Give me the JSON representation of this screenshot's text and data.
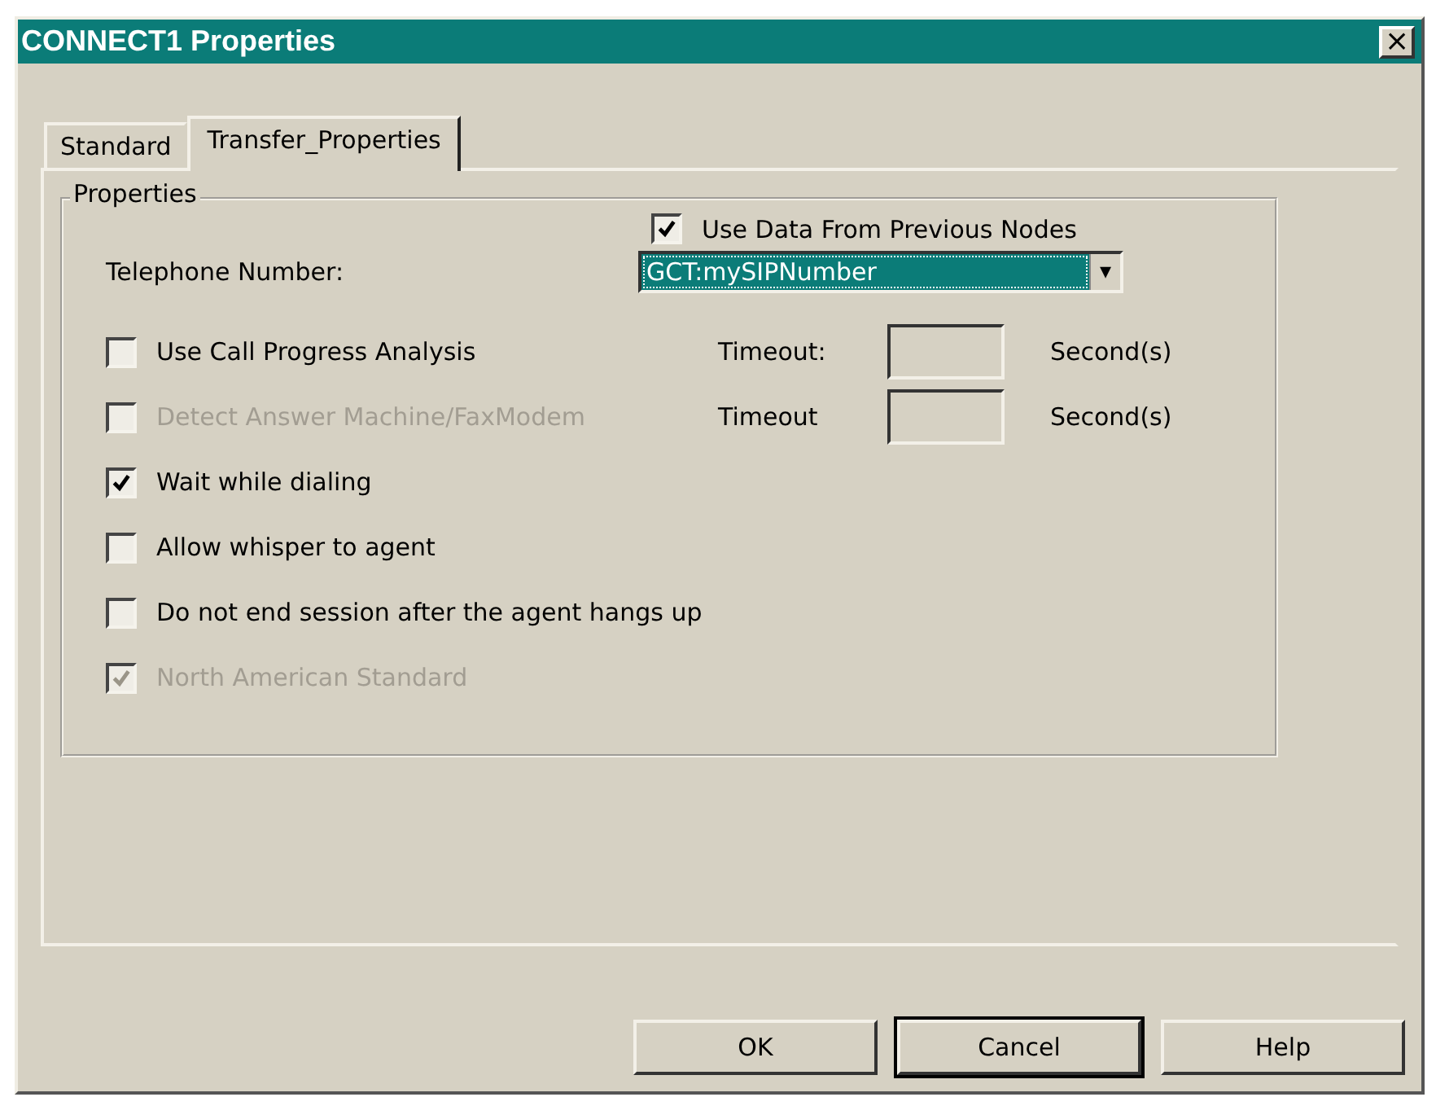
{
  "window": {
    "title": "CONNECT1 Properties",
    "close_glyph": "×"
  },
  "tabs": [
    {
      "label": "Standard",
      "selected": false
    },
    {
      "label": "Transfer_Properties",
      "selected": true
    }
  ],
  "group": {
    "title": "Properties",
    "use_previous": {
      "label": "Use Data From Previous Nodes",
      "checked": true
    },
    "telephone": {
      "label": "Telephone Number:",
      "value": "GCT:mySIPNumber",
      "arrow": "▾"
    },
    "options": [
      {
        "label": "Use Call Progress Analysis",
        "checked": false,
        "disabled": false,
        "timeout": {
          "label": "Timeout:",
          "unit": "Second(s)"
        }
      },
      {
        "label": "Detect Answer Machine/FaxModem",
        "checked": false,
        "disabled": true,
        "timeout": {
          "label": "Timeout",
          "unit": "Second(s)"
        }
      },
      {
        "label": "Wait while dialing",
        "checked": true,
        "disabled": false
      },
      {
        "label": "Allow whisper to agent",
        "checked": false,
        "disabled": false
      },
      {
        "label": "Do not end session after the agent hangs up",
        "checked": false,
        "disabled": false
      },
      {
        "label": "North American Standard",
        "checked": true,
        "disabled": true
      }
    ]
  },
  "buttons": [
    {
      "label": "OK",
      "default": false
    },
    {
      "label": "Cancel",
      "default": true
    },
    {
      "label": "Help",
      "default": false
    }
  ]
}
